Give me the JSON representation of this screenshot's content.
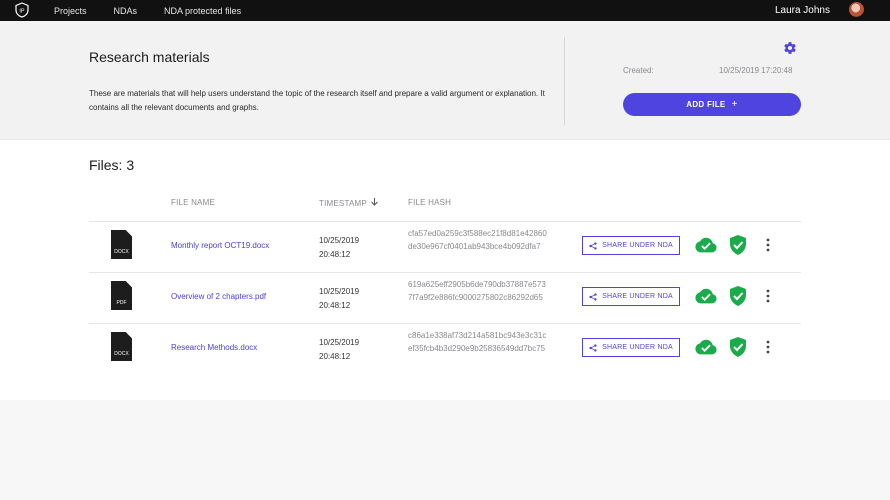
{
  "nav": {
    "logo_text": "IP",
    "items": [
      "Projects",
      "NDAs",
      "NDA protected files"
    ]
  },
  "user": {
    "name": "Laura Johns"
  },
  "header": {
    "title": "Research materials",
    "description": "These are materials that will help users understand the topic of the research itself and prepare a valid argument or explanation. It contains all the relevant documents and graphs.",
    "created_label": "Created:",
    "created_value": "10/25/2019 17:20:48",
    "add_file_label": "ADD FILE",
    "add_file_icon": "+"
  },
  "files_section": {
    "title": "Files: 3",
    "headers": {
      "name": "FILE NAME",
      "timestamp": "TIMESTAMP",
      "hash": "FILE HASH"
    },
    "share_label": "SHARE UNDER NDA",
    "rows": [
      {
        "ext": "DOCX",
        "name": "Monthly report OCT19.docx",
        "date": "10/25/2019",
        "time": "20:48:12",
        "hash": "cfa57ed0a259c3f588ec21f8d81e42860de30e967cf0401ab943bce4b092dfa7"
      },
      {
        "ext": "PDF",
        "name": "Overview of 2 chapters.pdf",
        "date": "10/25/2019",
        "time": "20:48:12",
        "hash": "619a625eff2905b6de790db37887e5737f7a9f2e886fc9000275802c86292d65"
      },
      {
        "ext": "DOCX",
        "name": "Research Methods.docx",
        "date": "10/25/2019",
        "time": "20:48:12",
        "hash": "c86a1e338af73d214a581bc943e3c31cef35fcb4b3d290e9b25836549dd7bc75"
      }
    ]
  },
  "colors": {
    "accent": "#4f44e0",
    "success": "#1aab4b",
    "topbar": "#111111"
  },
  "icons": {
    "logo": "shield-logo-icon",
    "gear": "gear-icon",
    "share": "share-icon",
    "cloud": "cloud-check-icon",
    "shield": "shield-check-icon",
    "kebab": "more-vertical-icon",
    "sort": "arrow-down-icon",
    "document": "document-icon"
  }
}
